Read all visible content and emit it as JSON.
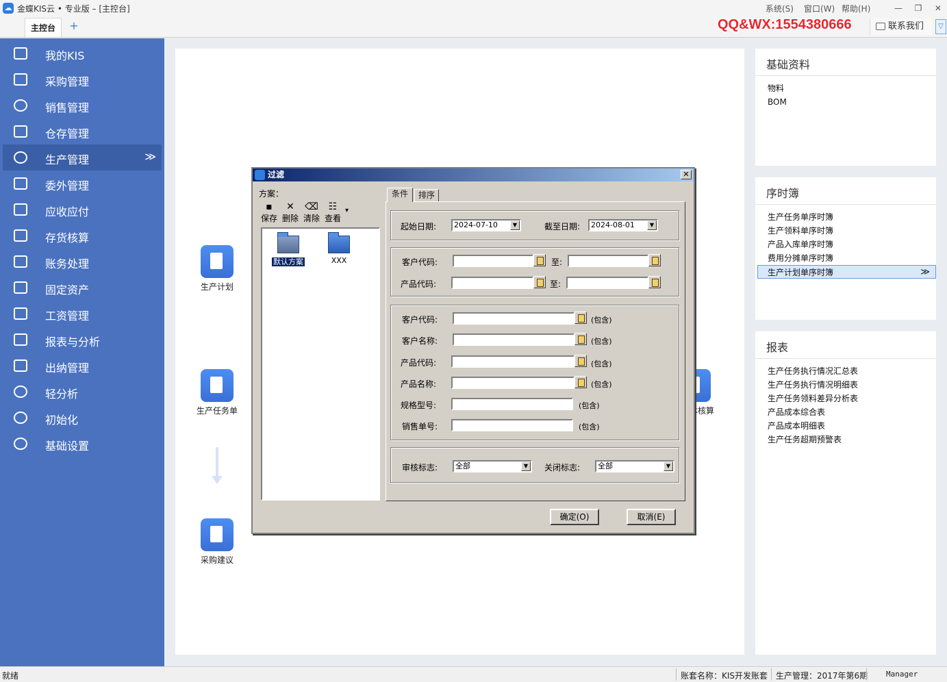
{
  "window": {
    "app_title": "金蝶KIS云 • 专业版 – [主控台]",
    "menu": [
      "系统(S)",
      "窗口(W)",
      "帮助(H)"
    ],
    "min": "—",
    "restore": "❐",
    "close": "✕"
  },
  "tabs": {
    "main": "主控台",
    "add": "+"
  },
  "promo": "QQ&WX:1554380666",
  "contact": "联系我们",
  "sidebar": {
    "items": [
      {
        "label": "我的KIS"
      },
      {
        "label": "采购管理"
      },
      {
        "label": "销售管理"
      },
      {
        "label": "仓存管理"
      },
      {
        "label": "生产管理"
      },
      {
        "label": "委外管理"
      },
      {
        "label": "应收应付"
      },
      {
        "label": "存货核算"
      },
      {
        "label": "账务处理"
      },
      {
        "label": "固定资产"
      },
      {
        "label": "工资管理"
      },
      {
        "label": "报表与分析"
      },
      {
        "label": "出纳管理"
      },
      {
        "label": "轻分析"
      },
      {
        "label": "初始化"
      },
      {
        "label": "基础设置"
      }
    ],
    "active_chevron": "≫"
  },
  "flow": {
    "plan": "生产计划",
    "task": "生产任务单",
    "purchase_suggest": "采购建议",
    "cost_partial": "本核算"
  },
  "panels": {
    "basic": {
      "title": "基础资料",
      "items": [
        "物料",
        "BOM"
      ]
    },
    "ledger": {
      "title": "序时簿",
      "items": [
        "生产任务单序时簿",
        "生产领料单序时簿",
        "产品入库单序时簿",
        "费用分摊单序时簿",
        "生产计划单序时簿"
      ],
      "active_chevron": "≫"
    },
    "reports": {
      "title": "报表",
      "items": [
        "生产任务执行情况汇总表",
        "生产任务执行情况明细表",
        "生产任务领料差异分析表",
        "产品成本综合表",
        "产品成本明细表",
        "生产任务超期预警表"
      ]
    }
  },
  "status": {
    "ready": "就绪",
    "account": "账套名称：KIS开发账套",
    "period": "生产管理：2017年第6期",
    "user": "Manager"
  },
  "dialog": {
    "title": "过滤",
    "close": "✕",
    "scheme_label": "方案：",
    "toolbar": [
      {
        "label": "保存",
        "glyph": "▪"
      },
      {
        "label": "删除",
        "glyph": "✕"
      },
      {
        "label": "清除",
        "glyph": "⌫"
      },
      {
        "label": "查看",
        "glyph": "☷"
      }
    ],
    "toolbar_more": "▾",
    "schemes": [
      "默认方案",
      "XXX"
    ],
    "tabs": [
      "条件",
      "排序"
    ],
    "start_date_label": "起始日期:",
    "start_date": "2024-07-10",
    "end_date_label": "截至日期:",
    "end_date": "2024-08-01",
    "range": {
      "customer_code": "客户代码:",
      "product_code": "产品代码:",
      "to": "至:"
    },
    "contains": {
      "customer_code": "客户代码:",
      "customer_name": "客户名称:",
      "product_code": "产品代码:",
      "product_name": "产品名称:",
      "spec": "规格型号:",
      "sales_no": "销售单号:",
      "hint": "(包含)"
    },
    "audit_label": "审核标志:",
    "audit_value": "全部",
    "close_label": "关闭标志:",
    "close_value": "全部",
    "ok": "确定(O)",
    "cancel": "取消(E)"
  }
}
